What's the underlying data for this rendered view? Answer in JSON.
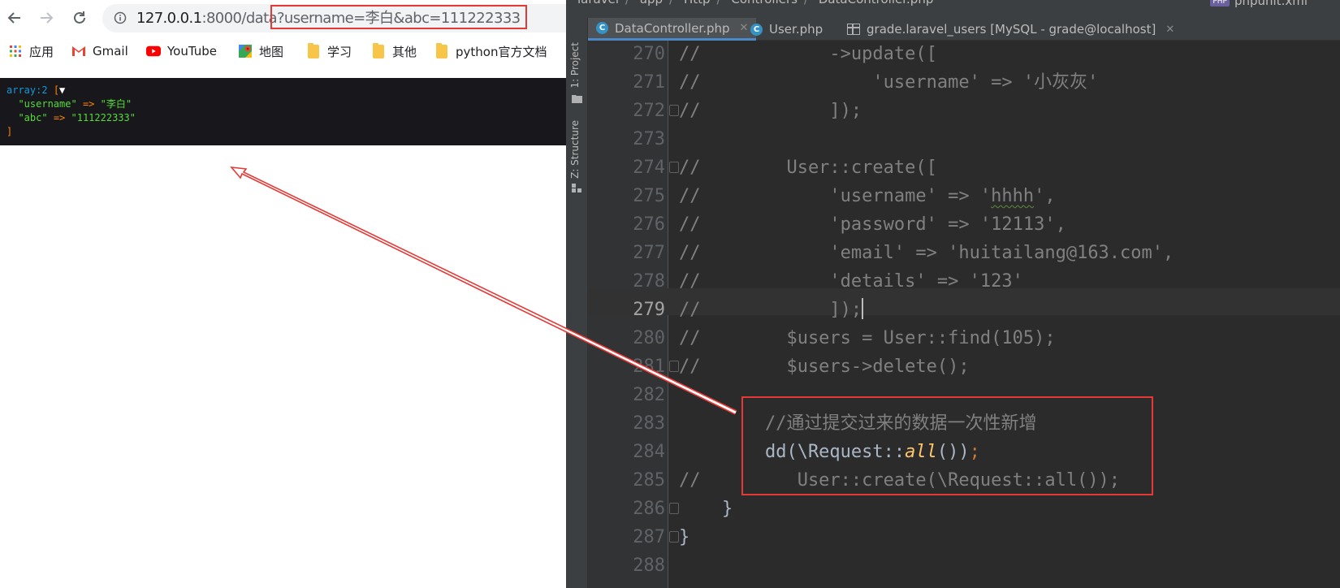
{
  "browser": {
    "url_host": "127.0.0.1",
    "url_rest": ":8000/data",
    "url_query": "?username=李白&abc=111222333",
    "bookmarks": [
      {
        "label": "应用",
        "icon": "apps-grid-icon"
      },
      {
        "label": "Gmail",
        "icon": "gmail-icon"
      },
      {
        "label": "YouTube",
        "icon": "youtube-icon"
      },
      {
        "label": "地图",
        "icon": "maps-icon"
      },
      {
        "label": "学习",
        "icon": "folder-icon"
      },
      {
        "label": "其他",
        "icon": "folder-icon"
      },
      {
        "label": "python官方文档",
        "icon": "folder-icon"
      }
    ],
    "dump": {
      "header": "array:2",
      "open": "[",
      "toggle": "▼",
      "entries": [
        {
          "key": "\"username\"",
          "arrow": "=>",
          "value": "\"李白\""
        },
        {
          "key": "\"abc\"",
          "arrow": "=>",
          "value": "\"111222333\""
        }
      ],
      "close": "]"
    }
  },
  "ide": {
    "breadcrumbs": [
      "laravel",
      "app",
      "Http",
      "Controllers",
      "DataController.php"
    ],
    "phpunit_label": "phpunit.xml",
    "phpunit_badge": "PHP",
    "side_labels": {
      "project": "1: Project",
      "structure": "Z: Structure"
    },
    "tabs": [
      {
        "label": "DataController.php",
        "icon": "php-class-icon",
        "active": true
      },
      {
        "label": "User.php",
        "icon": "php-class-icon",
        "active": false
      },
      {
        "label": "grade.laravel_users [MySQL - grade@localhost]",
        "icon": "table-icon",
        "active": false
      }
    ],
    "current_line": "279",
    "lines": [
      {
        "n": "270",
        "parts": [
          [
            "cm",
            "//            ->update(["
          ]
        ]
      },
      {
        "n": "271",
        "parts": [
          [
            "cm",
            "//                'username' => '小灰灰'"
          ]
        ]
      },
      {
        "n": "272",
        "parts": [
          [
            "cm",
            "//            ]);"
          ]
        ],
        "fold": true
      },
      {
        "n": "273",
        "parts": []
      },
      {
        "n": "274",
        "parts": [
          [
            "cm",
            "//        User::create(["
          ]
        ],
        "fold": true
      },
      {
        "n": "275",
        "parts": [
          [
            "cm",
            "//            'username' => '"
          ],
          [
            "cmsq",
            "hhhh"
          ],
          [
            "cm",
            "',"
          ]
        ]
      },
      {
        "n": "276",
        "parts": [
          [
            "cm",
            "//            'password' => '12113',"
          ]
        ]
      },
      {
        "n": "277",
        "parts": [
          [
            "cm",
            "//            'email' => 'huitailang@163.com',"
          ]
        ]
      },
      {
        "n": "278",
        "parts": [
          [
            "cm",
            "//            'details' => '123'"
          ]
        ]
      },
      {
        "n": "279",
        "parts": [
          [
            "cm",
            "//            ]);"
          ],
          [
            "caret",
            ""
          ]
        ]
      },
      {
        "n": "280",
        "parts": [
          [
            "cm",
            "//        $users = User::find(105);"
          ]
        ]
      },
      {
        "n": "281",
        "parts": [
          [
            "cm",
            "//        $users->delete();"
          ]
        ],
        "fold": true
      },
      {
        "n": "282",
        "parts": []
      },
      {
        "n": "283",
        "parts": [
          [
            "plain",
            "        "
          ],
          [
            "cm",
            "//通过提交过来的数据一次性新增"
          ]
        ]
      },
      {
        "n": "284",
        "parts": [
          [
            "plain",
            "        dd(\\Request::"
          ],
          [
            "fn",
            "all"
          ],
          [
            "plain",
            "())"
          ],
          [
            "kw",
            ";"
          ]
        ]
      },
      {
        "n": "285",
        "parts": [
          [
            "cm",
            "//         User::create(\\Request::all());"
          ]
        ]
      },
      {
        "n": "286",
        "parts": [
          [
            "plain",
            "    }"
          ]
        ],
        "fold": true
      },
      {
        "n": "287",
        "parts": [
          [
            "plain",
            "}"
          ]
        ],
        "fold": true
      },
      {
        "n": "288",
        "parts": []
      }
    ]
  },
  "colors": {
    "highlight_red": "#e53935",
    "ide_bg": "#2b2b2b",
    "comment": "#808080",
    "dump_bg": "#18171b"
  }
}
